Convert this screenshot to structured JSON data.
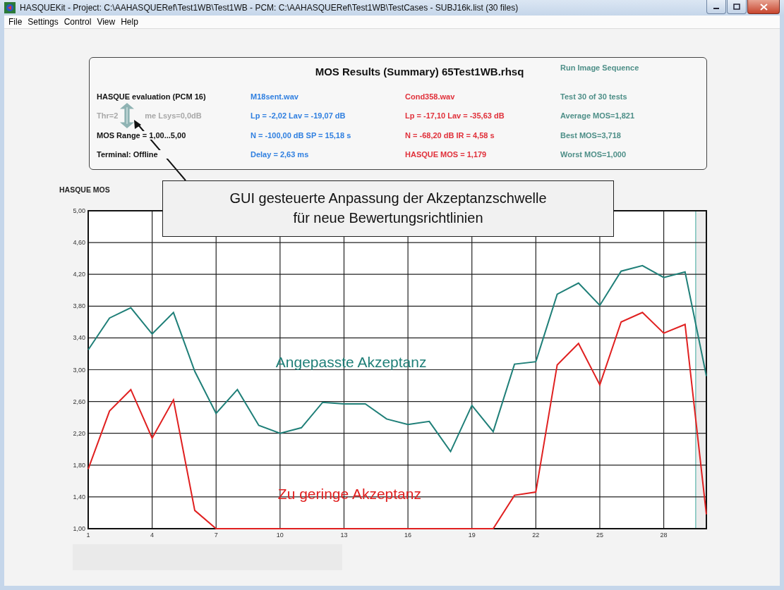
{
  "window": {
    "title": "HASQUEKit - Project: C:\\AAHASQUERef\\Test1WB\\Test1WB - PCM: C:\\AAHASQUERef\\Test1WB\\TestCases - SUBJ16k.list (30 files)"
  },
  "menu": [
    "File",
    "Settings",
    "Control",
    "View",
    "Help"
  ],
  "summary": {
    "title": "MOS Results (Summary) 65Test1WB.rhsq",
    "run_link": "Run Image Sequence",
    "columns": [
      {
        "kind": "setup",
        "items": [
          {
            "text": "HASQUE evaluation (PCM 16)",
            "dimmed": false
          },
          {
            "text": "Thr=2",
            "text_after": "me Lsys=0,0dB",
            "dimmed": true
          },
          {
            "text": "MOS Range = 1,00...5,00",
            "dimmed": false
          },
          {
            "text": "Terminal: Offline",
            "dimmed": false
          }
        ]
      },
      {
        "kind": "reference",
        "items": [
          {
            "text": "M18sent.wav"
          },
          {
            "text": "Lp = -2,02 Lav = -19,07 dB"
          },
          {
            "text": "N = -100,00 dB SP = 15,18 s"
          },
          {
            "text": "Delay = 2,63 ms"
          }
        ]
      },
      {
        "kind": "condition",
        "items": [
          {
            "text": "Cond358.wav"
          },
          {
            "text": "Lp = -17,10 Lav = -35,63 dB"
          },
          {
            "text": "N = -68,20 dB IR = 4,58 s"
          },
          {
            "text": "HASQUE MOS = 1,179"
          }
        ]
      },
      {
        "kind": "statistics",
        "items": [
          {
            "text": "Test 30 of 30 tests"
          },
          {
            "text": "Average MOS=1,821"
          },
          {
            "text": "Best MOS=3,718"
          },
          {
            "text": "Worst MOS=1,000"
          }
        ]
      }
    ]
  },
  "chart": {
    "chart_data": {
      "type": "line",
      "ylabel": "HASQUE MOS",
      "x": [
        1,
        2,
        3,
        4,
        5,
        6,
        7,
        8,
        9,
        10,
        11,
        12,
        13,
        14,
        15,
        16,
        17,
        18,
        19,
        20,
        21,
        22,
        23,
        24,
        25,
        26,
        27,
        28,
        29,
        30
      ],
      "series": [
        {
          "name": "Angepasste Akzeptanz",
          "color": "#1f7f78",
          "values": [
            3.25,
            3.65,
            3.78,
            3.45,
            3.72,
            2.98,
            2.45,
            2.75,
            2.3,
            2.2,
            2.27,
            2.59,
            2.57,
            2.57,
            2.38,
            2.31,
            2.35,
            1.97,
            2.55,
            2.22,
            3.07,
            3.1,
            3.95,
            4.09,
            3.81,
            4.24,
            4.31,
            4.16,
            4.23,
            2.92
          ]
        },
        {
          "name": "Zu geringe Akzeptanz",
          "color": "#e02020",
          "values": [
            1.75,
            2.48,
            2.75,
            2.14,
            2.62,
            1.23,
            1.0,
            1.0,
            1.0,
            1.0,
            1.0,
            1.0,
            1.0,
            1.0,
            1.0,
            1.0,
            1.0,
            1.0,
            1.0,
            1.0,
            1.42,
            1.46,
            3.06,
            3.33,
            2.81,
            3.6,
            3.72,
            3.46,
            3.57,
            1.18
          ]
        }
      ],
      "xlim": [
        1,
        30
      ],
      "ylim": [
        1,
        5
      ],
      "grid": true,
      "bands": [
        {
          "axis": "x",
          "from": 29.5,
          "to": 30,
          "color": "#ececec"
        }
      ],
      "xticks": [
        1,
        4,
        7,
        10,
        13,
        16,
        19,
        22,
        25,
        28
      ],
      "yticks": [
        {
          "value": 1,
          "label": "1,00"
        },
        {
          "value": 1.4,
          "label": "1,40"
        },
        {
          "value": 1.8,
          "label": "1,80"
        },
        {
          "value": 2.2,
          "label": "2,20"
        },
        {
          "value": 2.6,
          "label": "2,60"
        },
        {
          "value": 3,
          "label": "3,00"
        },
        {
          "value": 3.4,
          "label": "3,40"
        },
        {
          "value": 3.8,
          "label": "3,80"
        },
        {
          "value": 4.2,
          "label": "4,20"
        },
        {
          "value": 4.6,
          "label": "4,60"
        },
        {
          "value": 5,
          "label": "5,00"
        }
      ]
    }
  },
  "callout": {
    "text": "GUI gesteuerte Anpassung der Akzeptanzschwelle\nfür neue Bewertungsrichtlinien"
  }
}
